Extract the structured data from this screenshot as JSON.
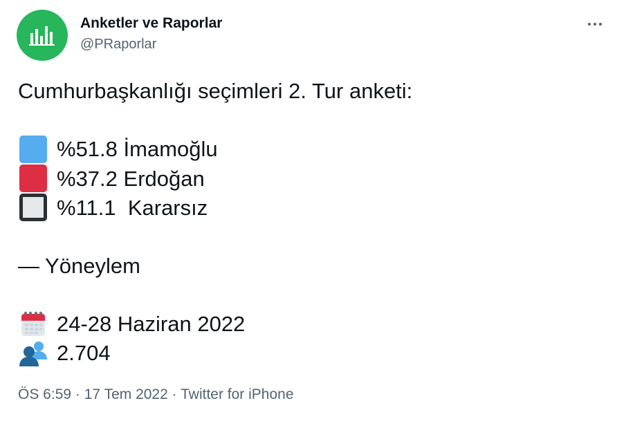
{
  "author": {
    "name": "Anketler ve Raporlar",
    "handle": "@PRaporlar",
    "avatar_color": "#27b65b",
    "avatar_icon": "bar-chart-icon"
  },
  "more_icon": "more-dots-icon",
  "tweet": {
    "title": "Cumhurbaşkanlığı seçimleri 2. Tur anketi:",
    "results": [
      {
        "swatch": "blue-square",
        "color": "#55acee",
        "text": "%51.8 İmamoğlu"
      },
      {
        "swatch": "red-square",
        "color": "#dd2e44",
        "text": "%37.2 Erdoğan"
      },
      {
        "swatch": "white-square",
        "color": "#e6e7e8",
        "text": "%11.1  Kararsız"
      }
    ],
    "source": "— Yöneylem",
    "date": {
      "icon": "calendar-icon",
      "text": "24-28 Haziran 2022"
    },
    "sample": {
      "icon": "people-icon",
      "text": "2.704"
    }
  },
  "meta": {
    "time": "ÖS 6:59",
    "separator": "·",
    "date": "17 Tem 2022",
    "client": "Twitter for iPhone"
  }
}
